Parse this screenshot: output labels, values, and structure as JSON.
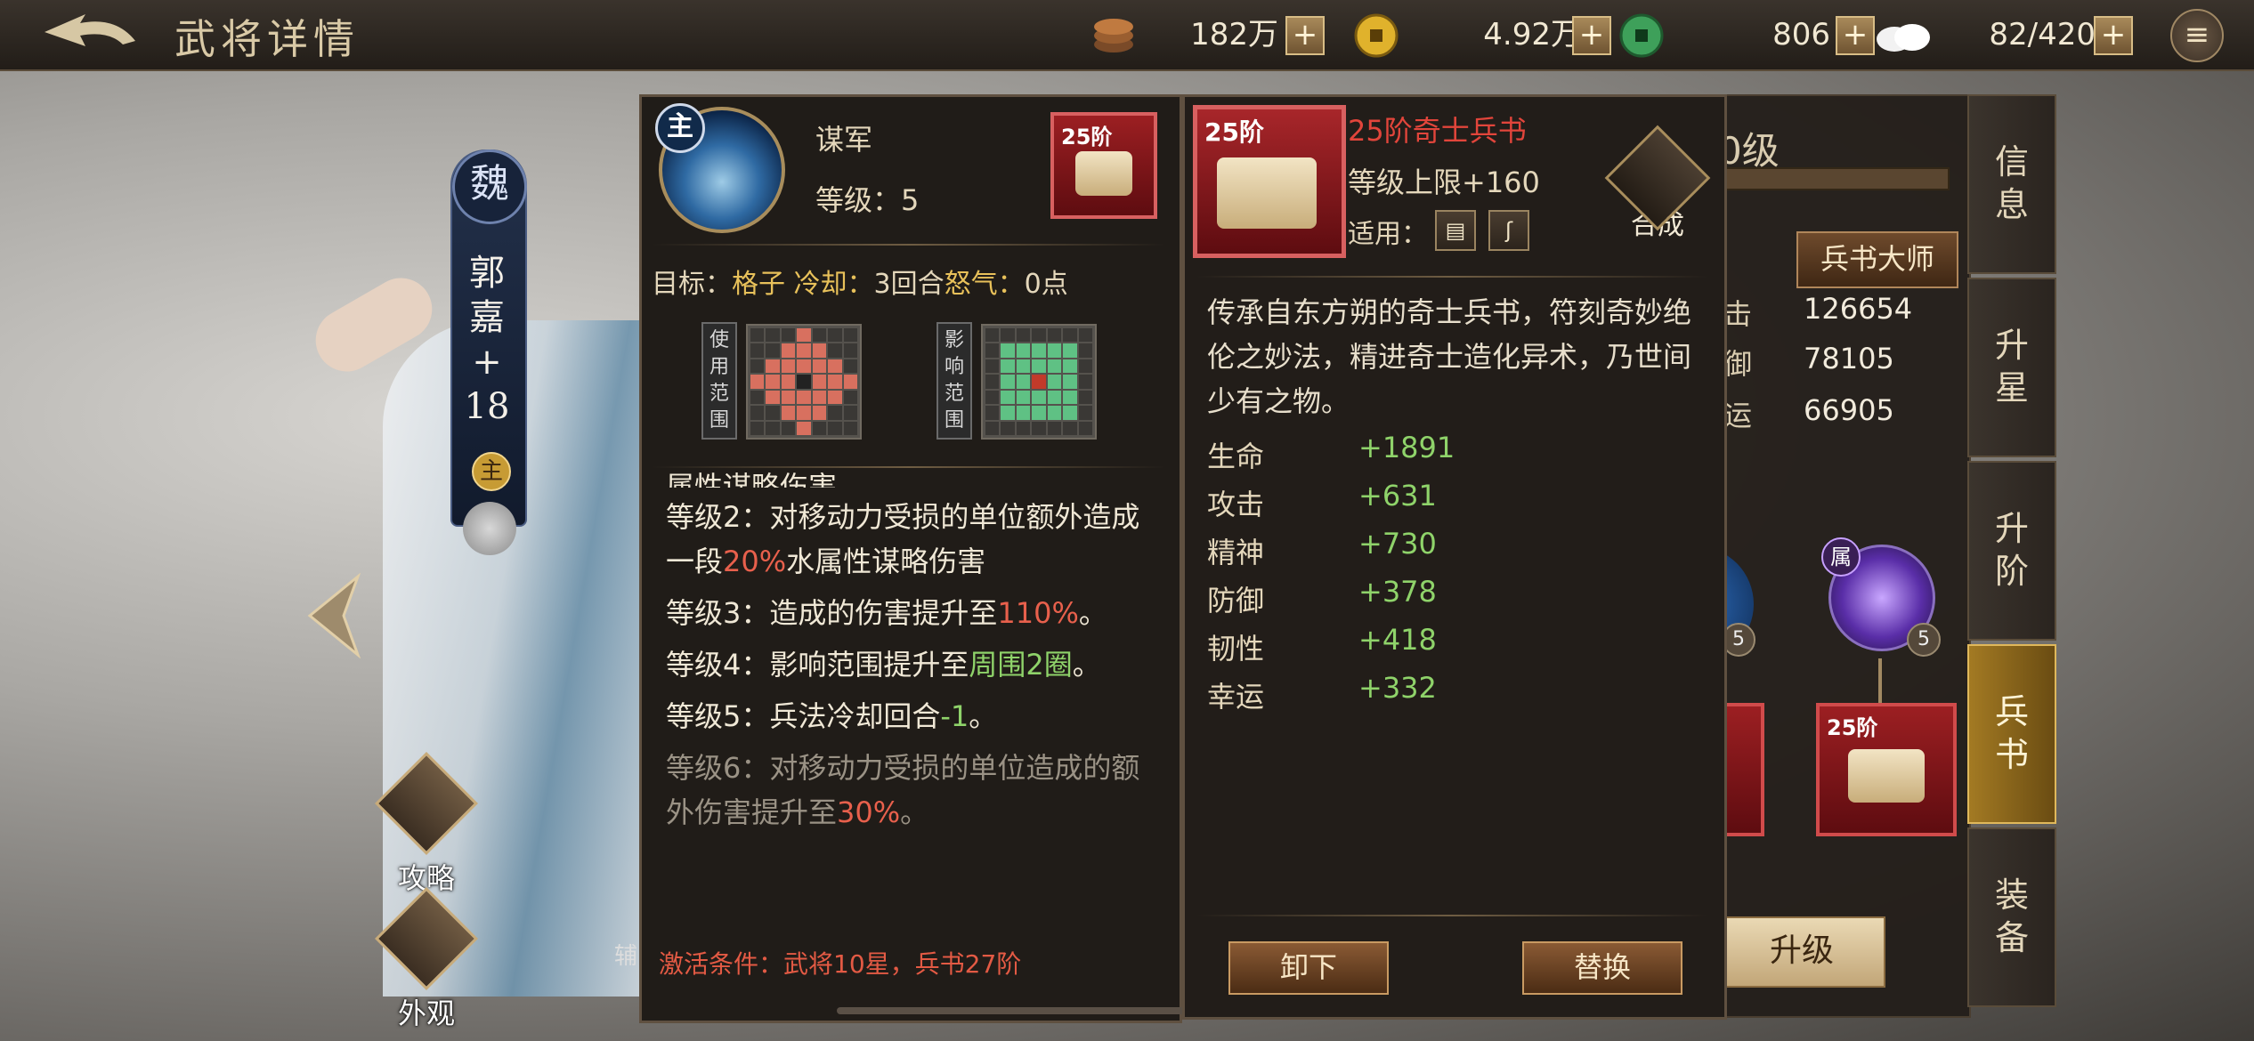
{
  "header": {
    "title": "武将详情",
    "resources": [
      {
        "icon": "coin-stack-icon",
        "value": "182万"
      },
      {
        "icon": "gold-coin-icon",
        "value": "4.92万"
      },
      {
        "icon": "jade-coin-icon",
        "value": "806"
      },
      {
        "icon": "steamed-bun-icon",
        "value": "82/420"
      }
    ]
  },
  "hero": {
    "faction": "魏",
    "name_lines": [
      "郭",
      "嘉",
      "+",
      "18"
    ],
    "main_badge": "主",
    "assist_label": "辅",
    "side_buttons": [
      {
        "label": "攻略"
      },
      {
        "label": "外观"
      }
    ]
  },
  "skill": {
    "badge": "主",
    "name": "谋军",
    "level": "等级：5",
    "book_tier": "25阶",
    "target_label": "目标：",
    "target_value": "格子",
    "cooldown_label": "冷却：",
    "cooldown_value": "3回合",
    "rage_label": "怒气：",
    "rage_value": "0点",
    "use_range_label": "使用范围",
    "effect_range_label": "影响范围",
    "desc_cut": "属性谋略伤害。",
    "levels": [
      {
        "pre": "等级2：对移动力受损的单位额外造成一段",
        "hl": "20%",
        "post": "水属性谋略伤害"
      },
      {
        "pre": "等级3：造成的伤害提升至",
        "hl": "110%",
        "post": "。"
      },
      {
        "pre": "等级4：影响范围提升至",
        "hl": "周围2圈",
        "post": "。"
      },
      {
        "pre": "等级5：兵法冷却回合",
        "hl": "-1",
        "post": "。"
      },
      {
        "pre": "等级6：对移动力受损的单位造成的额外伤害提升至",
        "hl": "30%",
        "post": "。"
      }
    ],
    "activation": "激活条件：武将10星，兵书27阶"
  },
  "book": {
    "tier": "25阶",
    "title": "25阶奇士兵书",
    "level_cap": "等级上限+160",
    "apply_label": "适用：",
    "combine_label": "合成",
    "description": "传承自东方朔的奇士兵书，符刻奇妙绝伦之妙法，精进奇士造化异术，乃世间少有之物。",
    "stats": [
      {
        "name": "生命",
        "value": "+1891"
      },
      {
        "name": "攻击",
        "value": "+631"
      },
      {
        "name": "精神",
        "value": "+730"
      },
      {
        "name": "防御",
        "value": "+378"
      },
      {
        "name": "韧性",
        "value": "+418"
      },
      {
        "name": "幸运",
        "value": "+332"
      }
    ],
    "unload_label": "卸下",
    "replace_label": "替换"
  },
  "right_panel": {
    "level_partial": "0级",
    "master_button": "兵书大师",
    "stats": [
      {
        "name": "击",
        "value": "126654"
      },
      {
        "name": "御",
        "value": "78105"
      },
      {
        "name": "运",
        "value": "66905"
      }
    ],
    "skill_levels": [
      "5",
      "5"
    ],
    "attr_tag": "属",
    "card_tier": "25阶",
    "upgrade_label": "升级"
  },
  "tabs": [
    {
      "label": "信息",
      "active": false
    },
    {
      "label": "升星",
      "active": false
    },
    {
      "label": "升阶",
      "active": false
    },
    {
      "label": "兵书",
      "active": true
    },
    {
      "label": "装备",
      "active": false
    }
  ]
}
